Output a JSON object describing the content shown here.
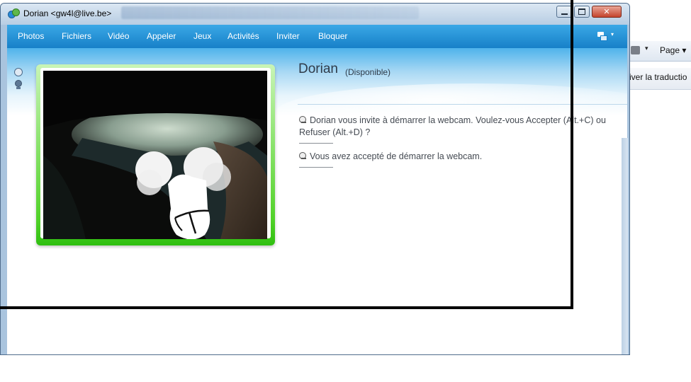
{
  "window": {
    "title": "Dorian <gw4l@live.be>",
    "close_glyph": "✕"
  },
  "menu": {
    "items": [
      "Photos",
      "Fichiers",
      "Vidéo",
      "Appeler",
      "Jeux",
      "Activités",
      "Inviter",
      "Bloquer"
    ],
    "options_arrow": "▾"
  },
  "contact": {
    "name": "Dorian",
    "status": "(Disponible)"
  },
  "conversation": {
    "messages": [
      "Dorian vous invite à démarrer la webcam. Voulez-vous Accepter (Alt.+C) ou Refuser (Alt.+D) ?",
      "Vous avez accepté de démarrer la webcam."
    ]
  },
  "background_browser": {
    "page_menu": "Page ▾",
    "print_arrow": "▾",
    "translate_label": "iver la traductio"
  },
  "colors": {
    "menubar": "#1780c8",
    "webcam_frame": "#52d22a",
    "overlay_stroke": "#000000"
  },
  "icons": [
    "messenger-logo-icon",
    "minimize-icon",
    "maximize-icon",
    "close-icon",
    "options-menu-icon",
    "webcam-icon",
    "print-icon"
  ]
}
